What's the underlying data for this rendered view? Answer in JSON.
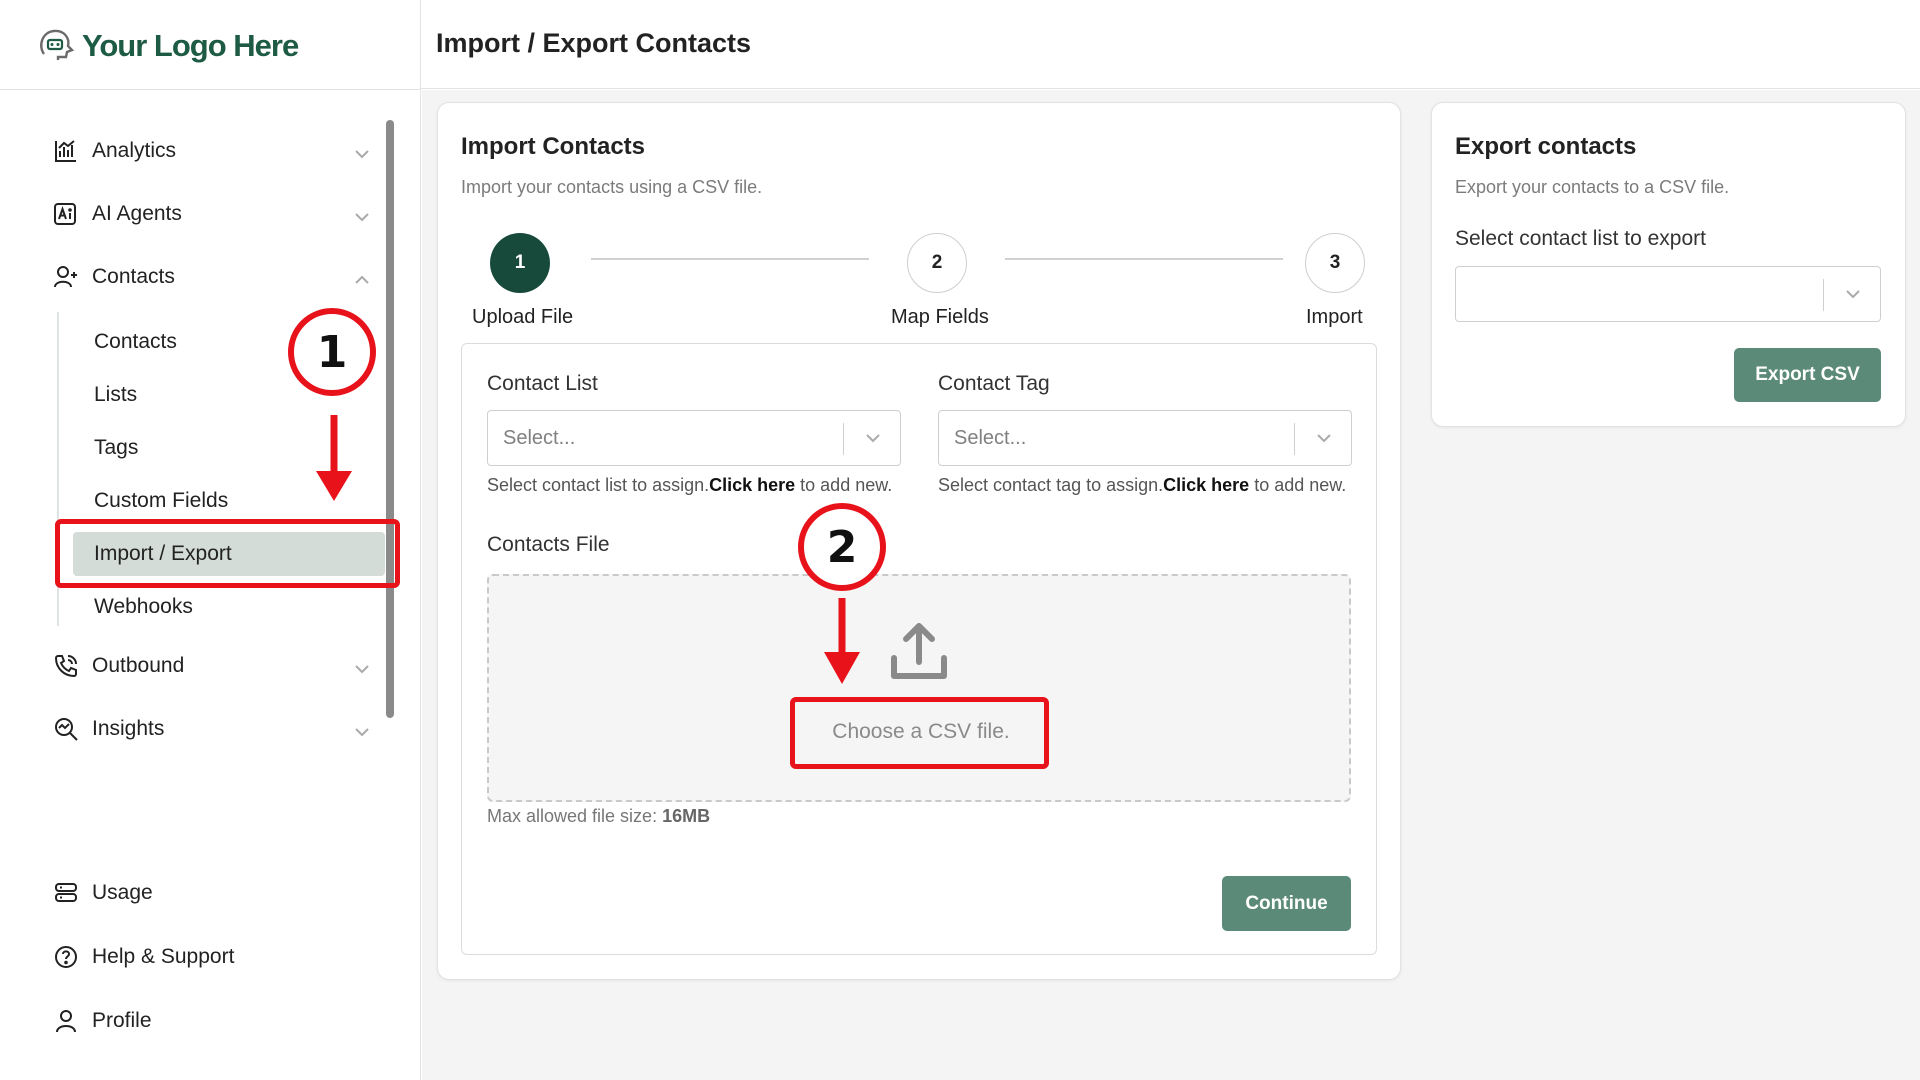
{
  "brand": {
    "logo_text": "Your Logo Here",
    "accent": "#174a3b",
    "button_color": "#5c8a79",
    "annotation_color": "#e8121b"
  },
  "header": {
    "title": "Import / Export Contacts"
  },
  "sidebar": {
    "items": [
      {
        "label": "Analytics",
        "icon": "analytics-icon",
        "expanded": false
      },
      {
        "label": "AI Agents",
        "icon": "ai-agents-icon",
        "expanded": false
      },
      {
        "label": "Contacts",
        "icon": "contacts-icon",
        "expanded": true
      },
      {
        "label": "Outbound",
        "icon": "phone-icon",
        "expanded": false
      },
      {
        "label": "Insights",
        "icon": "insights-icon",
        "expanded": false
      }
    ],
    "contacts_sub": [
      "Contacts",
      "Lists",
      "Tags",
      "Custom Fields",
      "Import / Export",
      "Webhooks"
    ],
    "active_sub": "Import / Export",
    "bottom": [
      {
        "label": "Usage",
        "icon": "usage-icon"
      },
      {
        "label": "Help & Support",
        "icon": "help-icon"
      },
      {
        "label": "Profile",
        "icon": "profile-icon"
      }
    ]
  },
  "import_card": {
    "title": "Import Contacts",
    "subtitle": "Import your contacts using a CSV file.",
    "steps": [
      {
        "number": "1",
        "label": "Upload File",
        "state": "done"
      },
      {
        "number": "2",
        "label": "Map Fields",
        "state": "todo"
      },
      {
        "number": "3",
        "label": "Import",
        "state": "todo"
      }
    ],
    "contact_list": {
      "label": "Contact List",
      "placeholder": "Select...",
      "help_prefix": "Select contact list to assign.",
      "help_link": "Click here",
      "help_suffix": " to add new."
    },
    "contact_tag": {
      "label": "Contact Tag",
      "placeholder": "Select...",
      "help_prefix": "Select contact tag to assign.",
      "help_link": "Click here",
      "help_suffix": " to add new."
    },
    "file": {
      "label": "Contacts File",
      "choose_label": "Choose a CSV file.",
      "note_prefix": "Max allowed file size: ",
      "note_value": "16MB"
    },
    "continue_label": "Continue"
  },
  "export_card": {
    "title": "Export contacts",
    "subtitle": "Export your contacts to a CSV file.",
    "select_label": "Select contact list to export",
    "select_value": "",
    "button_label": "Export CSV"
  },
  "annotations": {
    "step1": "1",
    "step2": "2"
  }
}
